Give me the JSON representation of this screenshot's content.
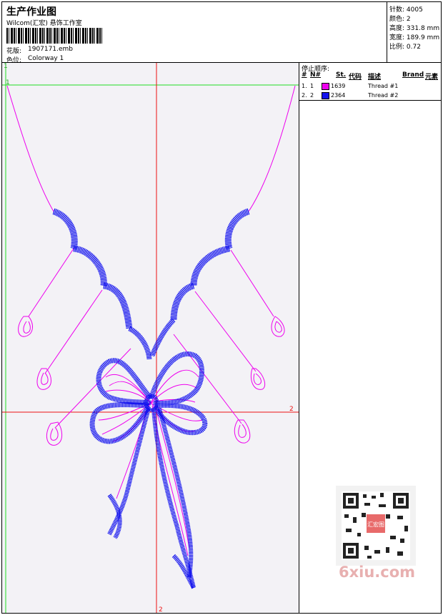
{
  "header": {
    "title": "生产作业图",
    "studio": "Wilcom(汇宏) 悬饰工作室",
    "design_label": "花版:",
    "design_value": "1907171.emb",
    "colorway_label": "色位:",
    "colorway_value": "Colorway 1"
  },
  "stats": [
    {
      "label": "针数:",
      "value": "4005"
    },
    {
      "label": "颜色:",
      "value": "2"
    },
    {
      "label": "高度:",
      "value": "331.8 mm"
    },
    {
      "label": "宽度:",
      "value": "189.9 mm"
    },
    {
      "label": "比例:",
      "value": "0.72"
    }
  ],
  "threads": {
    "stop_order_label": "停止顺序:",
    "col_num": "#",
    "col_n": "N#",
    "col_st": "St.",
    "col_code": "代码",
    "col_desc": "描述",
    "col_brand": "Brand",
    "col_elem": "元素",
    "rows": [
      {
        "num": "1.",
        "n": "1",
        "code": "1639",
        "desc": "Thread #1",
        "color": "#ee00ee"
      },
      {
        "num": "2.",
        "n": "2",
        "code": "2364",
        "desc": "Thread #2",
        "color": "#1414ee"
      }
    ]
  },
  "canvas": {
    "axis_marker_top": "1",
    "axis_marker_left": "1",
    "axis_marker_right": "2",
    "axis_marker_bottom": "2"
  },
  "watermark": {
    "qr_stamp": "汇宏图",
    "site": "6xiu.com"
  }
}
